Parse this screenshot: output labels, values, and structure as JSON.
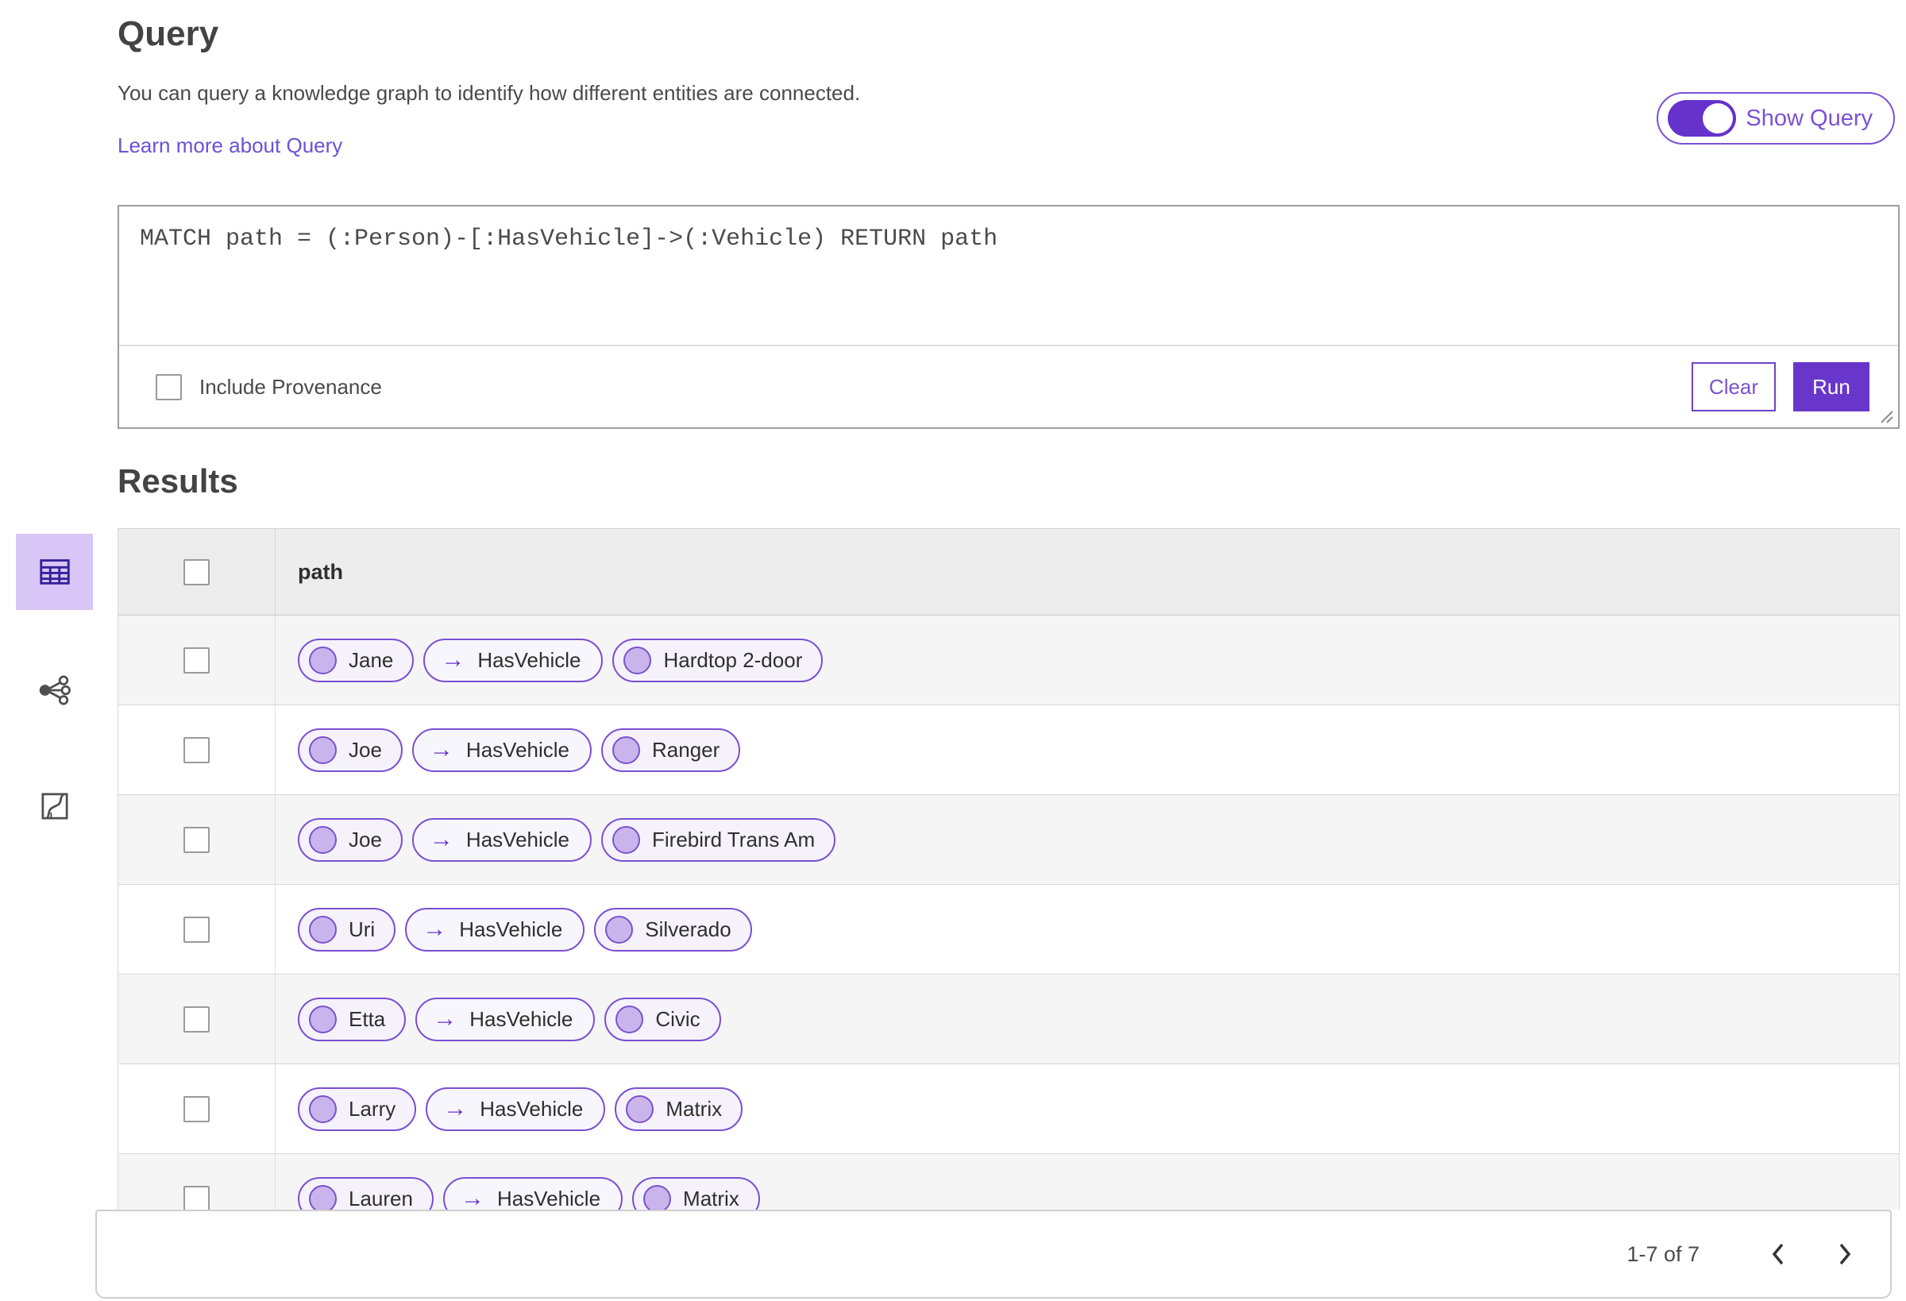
{
  "colors": {
    "accent_purple": "#6632cc",
    "pill_border": "#7a4fd2",
    "pill_background": "#f5f2fc",
    "node_circle_fill": "#c9b4ec",
    "selected_view_background": "#d8c6f6",
    "link_text": "#6a52d6",
    "table_header_background": "#ededed",
    "row_alternate_background": "#f5f5f5"
  },
  "query_section": {
    "title": "Query",
    "description": "You can query a knowledge graph to identify how different entities are connected.",
    "learn_more_link": "Learn more about Query",
    "show_query_toggle": {
      "label": "Show Query",
      "state": "on"
    },
    "editor": {
      "query_text": "MATCH path = (:Person)-[:HasVehicle]->(:Vehicle) RETURN path"
    },
    "include_provenance": {
      "label": "Include Provenance",
      "checked": false
    },
    "clear_button_label": "Clear",
    "run_button_label": "Run"
  },
  "results_section": {
    "title": "Results",
    "view_switcher": [
      {
        "icon": "table-view-icon",
        "selected": true
      },
      {
        "icon": "link-chart-view-icon",
        "selected": false
      },
      {
        "icon": "map-view-icon",
        "selected": false
      }
    ],
    "table": {
      "select_all_checked": false,
      "columns": [
        "path"
      ],
      "rows": [
        {
          "source": "Jane",
          "relation": "HasVehicle",
          "target": "Hardtop 2-door"
        },
        {
          "source": "Joe",
          "relation": "HasVehicle",
          "target": "Ranger"
        },
        {
          "source": "Joe",
          "relation": "HasVehicle",
          "target": "Firebird Trans Am"
        },
        {
          "source": "Uri",
          "relation": "HasVehicle",
          "target": "Silverado"
        },
        {
          "source": "Etta",
          "relation": "HasVehicle",
          "target": "Civic"
        },
        {
          "source": "Larry",
          "relation": "HasVehicle",
          "target": "Matrix"
        },
        {
          "source": "Lauren",
          "relation": "HasVehicle",
          "target": "Matrix"
        }
      ]
    },
    "pagination": {
      "range_label": "1-7 of 7",
      "prev_icon": "chevron-left-icon",
      "next_icon": "chevron-right-icon"
    }
  },
  "icons": {
    "arrow_right": "→"
  }
}
